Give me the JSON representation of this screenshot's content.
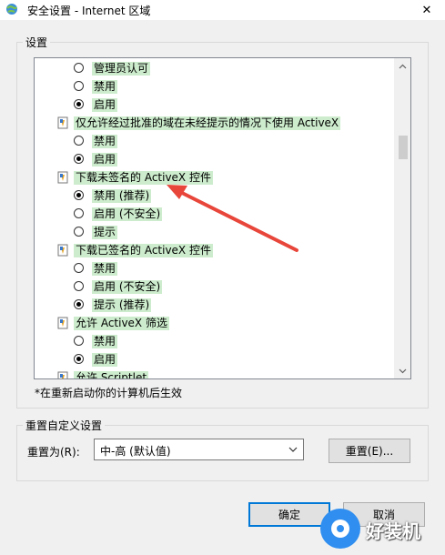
{
  "window": {
    "title": "安全设置 - Internet 区域",
    "close_glyph": "✕"
  },
  "settings": {
    "legend": "设置",
    "rows": [
      {
        "type": "option",
        "label": "管理员认可",
        "checked": false
      },
      {
        "type": "option",
        "label": "禁用",
        "checked": false
      },
      {
        "type": "option",
        "label": "启用",
        "checked": true
      },
      {
        "type": "category",
        "label": "仅允许经过批准的域在未经提示的情况下使用 ActiveX"
      },
      {
        "type": "option",
        "label": "禁用",
        "checked": false
      },
      {
        "type": "option",
        "label": "启用",
        "checked": true
      },
      {
        "type": "category",
        "label": "下载未签名的 ActiveX 控件"
      },
      {
        "type": "option",
        "label": "禁用 (推荐)",
        "checked": true
      },
      {
        "type": "option",
        "label": "启用 (不安全)",
        "checked": false
      },
      {
        "type": "option",
        "label": "提示",
        "checked": false
      },
      {
        "type": "category",
        "label": "下载已签名的 ActiveX 控件"
      },
      {
        "type": "option",
        "label": "禁用",
        "checked": false
      },
      {
        "type": "option",
        "label": "启用 (不安全)",
        "checked": false
      },
      {
        "type": "option",
        "label": "提示 (推荐)",
        "checked": true
      },
      {
        "type": "category",
        "label": "允许 ActiveX 筛选"
      },
      {
        "type": "option",
        "label": "禁用",
        "checked": false
      },
      {
        "type": "option",
        "label": "启用",
        "checked": true
      },
      {
        "type": "category",
        "label": "允许 Scriptlet"
      }
    ],
    "footnote": "*在重新启动你的计算机后生效"
  },
  "reset": {
    "legend": "重置自定义设置",
    "label": "重置为(R):",
    "selected": "中-高 (默认值)",
    "button": "重置(E)..."
  },
  "buttons": {
    "ok": "确定",
    "cancel": "取消"
  },
  "watermark": {
    "text": "好装机"
  },
  "colors": {
    "highlight": "#cdeccd",
    "annotation_arrow": "#e8463a",
    "focus_border": "#0078d7"
  }
}
